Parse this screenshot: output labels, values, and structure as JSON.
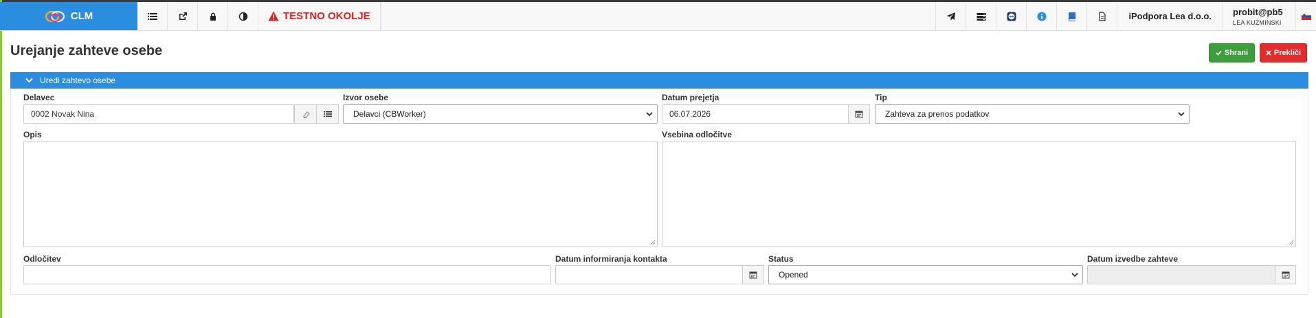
{
  "navbar": {
    "brand": "CLM",
    "test_env": "TESTNO OKOLJE",
    "company": "iPodpora Lea d.o.o.",
    "user_login": "probit@pb5",
    "user_name": "LEA KUZMINSKI",
    "icons_left": [
      "list-icon",
      "external-link-icon",
      "lock-icon",
      "contrast-icon"
    ],
    "icons_right": [
      "send-icon",
      "server-icon",
      "teamviewer-icon",
      "info-icon",
      "book-icon",
      "document-icon"
    ],
    "flag": "slovenia-flag-icon"
  },
  "page": {
    "title": "Urejanje zahteve osebe",
    "save_label": "Shrani",
    "cancel_label": "Prekliči"
  },
  "panel": {
    "header": "Uredi zahtevo osebe"
  },
  "form": {
    "delavec_label": "Delavec",
    "delavec_value": "0002 Novak Nina",
    "izvor_label": "Izvor osebe",
    "izvor_value": "Delavci (CBWorker)",
    "datum_prejetja_label": "Datum prejetja",
    "datum_prejetja_value": "06.07.2026",
    "tip_label": "Tip",
    "tip_value": "Zahteva za prenos podatkov",
    "opis_label": "Opis",
    "vsebina_label": "Vsebina odločitve",
    "odlocitev_label": "Odločitev",
    "datum_inf_label": "Datum informiranja kontakta",
    "status_label": "Status",
    "status_value": "Opened",
    "datum_izvedbe_label": "Datum izvedbe zahteve"
  },
  "colors": {
    "brand": "#2a8de0",
    "danger": "#e12d2d",
    "success": "#3c9f3c"
  }
}
